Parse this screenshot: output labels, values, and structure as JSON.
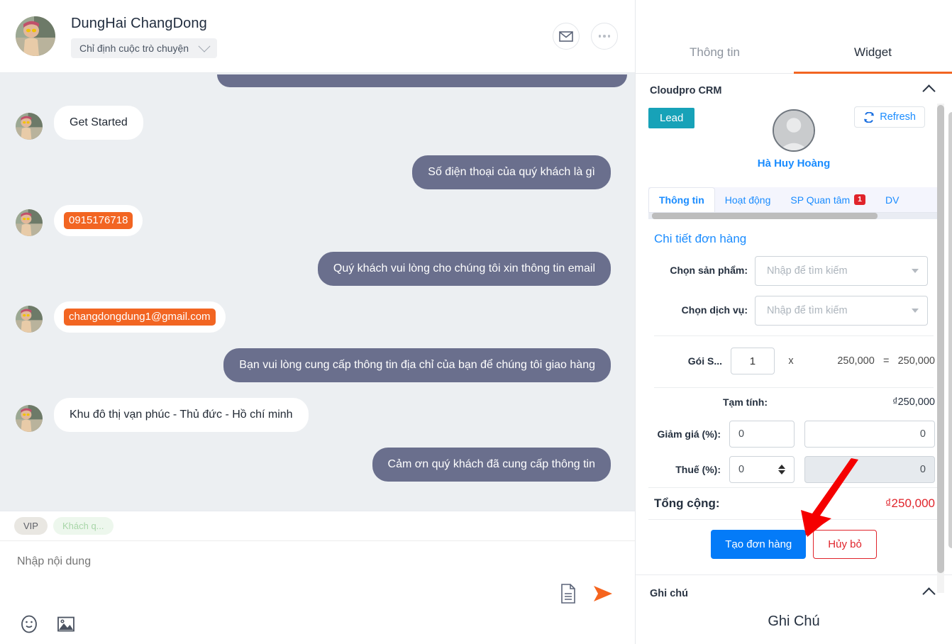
{
  "chat": {
    "header": {
      "contact_name": "DungHai ChangDong",
      "assign_label": "Chỉ định cuộc trò chuyện",
      "mail_icon": "envelope-icon",
      "more_icon": "more-horizontal-icon"
    },
    "messages": [
      {
        "side": "out",
        "text": "",
        "partial": true
      },
      {
        "side": "in",
        "text": "Get Started",
        "highlight": false
      },
      {
        "side": "out",
        "text": "Số điện thoại của quý khách là gì"
      },
      {
        "side": "in",
        "text": "0915176718",
        "highlight": true
      },
      {
        "side": "out",
        "text": "Quý khách vui lòng cho chúng tôi xin thông tin email"
      },
      {
        "side": "in",
        "text": "changdongdung1@gmail.com",
        "highlight": true
      },
      {
        "side": "out",
        "text": "Bạn vui lòng cung cấp thông tin địa chỉ của bạn để chúng tôi giao hàng"
      },
      {
        "side": "in",
        "text": "Khu đô thị vạn phúc - Thủ đức - Hồ chí minh",
        "highlight": false
      },
      {
        "side": "out",
        "text": "Cảm ơn quý khách đã cung cấp thông tin"
      }
    ],
    "tags": [
      {
        "label": "VIP",
        "style": "vip"
      },
      {
        "label": "Khách q...",
        "style": "guest"
      }
    ],
    "composer": {
      "placeholder": "Nhập nội dung",
      "value": "",
      "template_icon": "document-template-icon",
      "send_icon": "send-arrow-icon",
      "emoji_icon": "emoji-smiley-icon",
      "image_icon": "image-attach-icon"
    }
  },
  "side": {
    "tabs": [
      {
        "label": "Thông tin",
        "active": false
      },
      {
        "label": "Widget",
        "active": true
      }
    ],
    "widget": {
      "title": "Cloudpro CRM",
      "collapse_icon": "chevron-up-icon",
      "lead_badge": "Lead",
      "refresh_label": "Refresh",
      "refresh_icon": "refresh-icon",
      "avatar_icon": "user-placeholder-icon",
      "person_name": "Hà Huy Hoàng",
      "crm_tabs": [
        {
          "label": "Thông tin",
          "active": true,
          "badge": ""
        },
        {
          "label": "Hoạt động",
          "active": false,
          "badge": ""
        },
        {
          "label": "SP Quan tâm",
          "active": false,
          "badge": "1"
        },
        {
          "label": "DV",
          "active": false,
          "badge": ""
        }
      ],
      "order": {
        "section_title": "Chi tiết đơn hàng",
        "product_label": "Chọn sản phẩm:",
        "product_placeholder": "Nhập để tìm kiếm",
        "product_value": "",
        "service_label": "Chọn dịch vụ:",
        "service_placeholder": "Nhập để tìm kiếm",
        "service_value": "",
        "line_item": {
          "name": "Gói S...",
          "qty": "1",
          "mult": "x",
          "unit_price": "250,000",
          "equals": "=",
          "line_total": "250,000"
        },
        "subtotal_label": "Tạm tính:",
        "subtotal_value": "₫250,000",
        "discount_label": "Giảm giá (%):",
        "discount_pct": "0",
        "discount_amount": "0",
        "tax_label": "Thuế (%):",
        "tax_pct": "0",
        "tax_amount": "0",
        "grand_label": "Tổng cộng:",
        "grand_value": "₫250,000",
        "create_button": "Tạo đơn hàng",
        "cancel_button": "Hủy bỏ"
      }
    },
    "note": {
      "title": "Ghi chú",
      "collapse_icon": "chevron-up-icon",
      "heading": "Ghi Chú"
    }
  },
  "colors": {
    "accent_orange": "#f26522",
    "bubble_out": "#6a6f8d",
    "chat_bg": "#eceff2",
    "link_blue": "#1a8cff",
    "primary_blue": "#047bf8",
    "danger_red": "#e0242b",
    "lead_teal": "#17a2b8",
    "arrow_red": "#f50000"
  }
}
